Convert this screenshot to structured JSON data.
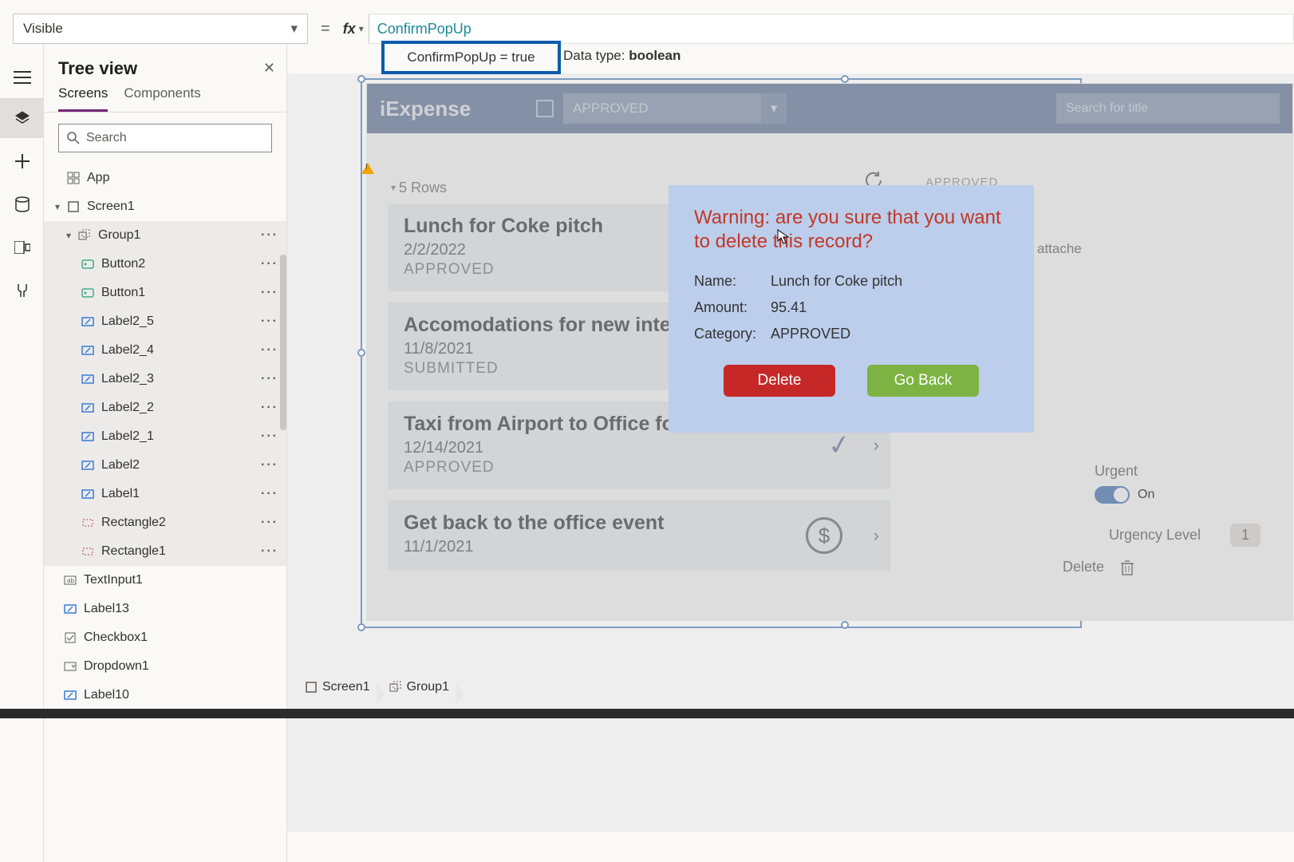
{
  "property": {
    "name": "Visible"
  },
  "formula": {
    "text": "ConfirmPopUp",
    "eval": "ConfirmPopUp = true",
    "data_type_label": "Data type: ",
    "data_type_value": "boolean"
  },
  "tree": {
    "title": "Tree view",
    "tabs": {
      "screens": "Screens",
      "components": "Components"
    },
    "search_placeholder": "Search",
    "app": "App",
    "screen": "Screen1",
    "group": "Group1",
    "items": [
      "Button2",
      "Button1",
      "Label2_5",
      "Label2_4",
      "Label2_3",
      "Label2_2",
      "Label2_1",
      "Label2",
      "Label1",
      "Rectangle2",
      "Rectangle1"
    ],
    "after": [
      "TextInput1",
      "Label13",
      "Checkbox1",
      "Dropdown1",
      "Label10"
    ]
  },
  "app": {
    "title": "iExpense",
    "dropdown": "APPROVED",
    "search_placeholder": "Search for title",
    "rowcount": "5 Rows",
    "cards": [
      {
        "title": "Lunch for Coke pitch",
        "date": "2/2/2022",
        "status": "APPROVED"
      },
      {
        "title": "Accomodations for new interv",
        "date": "11/8/2021",
        "status": "SUBMITTED"
      },
      {
        "title": "Taxi from Airport to Office for the festival",
        "date": "12/14/2021",
        "status": "APPROVED"
      },
      {
        "title": "Get back to the office event",
        "date": "11/1/2021",
        "status": ""
      }
    ]
  },
  "popup": {
    "warning": "Warning: are you sure that you want to delete this record?",
    "labels": {
      "name": "Name:",
      "amount": "Amount:",
      "category": "Category:"
    },
    "values": {
      "name": "Lunch for Coke pitch",
      "amount": "95.41",
      "category": "APPROVED"
    },
    "delete": "Delete",
    "goback": "Go Back"
  },
  "side": {
    "approved": "APPROVED",
    "attach": "attache",
    "urgent_label": "Urgent",
    "toggle_text": "On",
    "urgency_label": "Urgency Level",
    "urgency_value": "1",
    "delete_label": "Delete"
  },
  "breadcrumb": {
    "screen": "Screen1",
    "group": "Group1"
  }
}
